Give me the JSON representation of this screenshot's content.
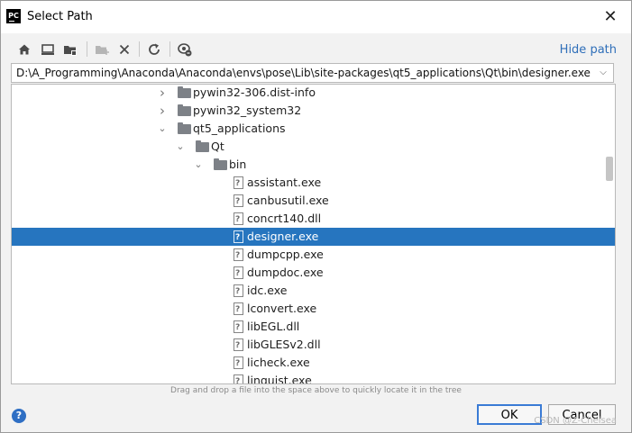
{
  "window": {
    "title": "Select Path",
    "close_glyph": "✕"
  },
  "toolbar": {
    "buttons": [
      {
        "name": "home-icon"
      },
      {
        "name": "desktop-icon"
      },
      {
        "name": "project-folder-icon"
      },
      {
        "name": "new-folder-icon"
      },
      {
        "name": "delete-icon"
      },
      {
        "name": "refresh-icon"
      },
      {
        "name": "show-hidden-icon"
      }
    ],
    "hide_path_label": "Hide path"
  },
  "path": {
    "value": "D:\\A_Programming\\Anaconda\\Anaconda\\envs\\pose\\Lib\\site-packages\\qt5_applications\\Qt\\bin\\designer.exe"
  },
  "tree": {
    "rows": [
      {
        "label": "pywin32-306.dist-info",
        "type": "folder",
        "depth": 0,
        "expander": "collapsed"
      },
      {
        "label": "pywin32_system32",
        "type": "folder",
        "depth": 0,
        "expander": "collapsed"
      },
      {
        "label": "qt5_applications",
        "type": "folder",
        "depth": 0,
        "expander": "expanded"
      },
      {
        "label": "Qt",
        "type": "folder",
        "depth": 1,
        "expander": "expanded"
      },
      {
        "label": "bin",
        "type": "folder",
        "depth": 2,
        "expander": "expanded"
      },
      {
        "label": "assistant.exe",
        "type": "file",
        "depth": 3,
        "expander": "none"
      },
      {
        "label": "canbusutil.exe",
        "type": "file",
        "depth": 3,
        "expander": "none"
      },
      {
        "label": "concrt140.dll",
        "type": "file",
        "depth": 3,
        "expander": "none"
      },
      {
        "label": "designer.exe",
        "type": "file",
        "depth": 3,
        "expander": "none",
        "selected": true
      },
      {
        "label": "dumpcpp.exe",
        "type": "file",
        "depth": 3,
        "expander": "none"
      },
      {
        "label": "dumpdoc.exe",
        "type": "file",
        "depth": 3,
        "expander": "none"
      },
      {
        "label": "idc.exe",
        "type": "file",
        "depth": 3,
        "expander": "none"
      },
      {
        "label": "lconvert.exe",
        "type": "file",
        "depth": 3,
        "expander": "none"
      },
      {
        "label": "libEGL.dll",
        "type": "file",
        "depth": 3,
        "expander": "none"
      },
      {
        "label": "libGLESv2.dll",
        "type": "file",
        "depth": 3,
        "expander": "none"
      },
      {
        "label": "licheck.exe",
        "type": "file",
        "depth": 3,
        "expander": "none"
      },
      {
        "label": "linguist.exe",
        "type": "file",
        "depth": 3,
        "expander": "none"
      }
    ]
  },
  "hint": "Drag and drop a file into the space above to quickly locate it in the tree",
  "buttons": {
    "ok": "OK",
    "cancel": "Cancel",
    "help": "?"
  },
  "watermark": "CSDN @Z-Chelsea",
  "colors": {
    "selection": "#2675bf",
    "link": "#2f6fb9",
    "help": "#2f6fc4"
  }
}
